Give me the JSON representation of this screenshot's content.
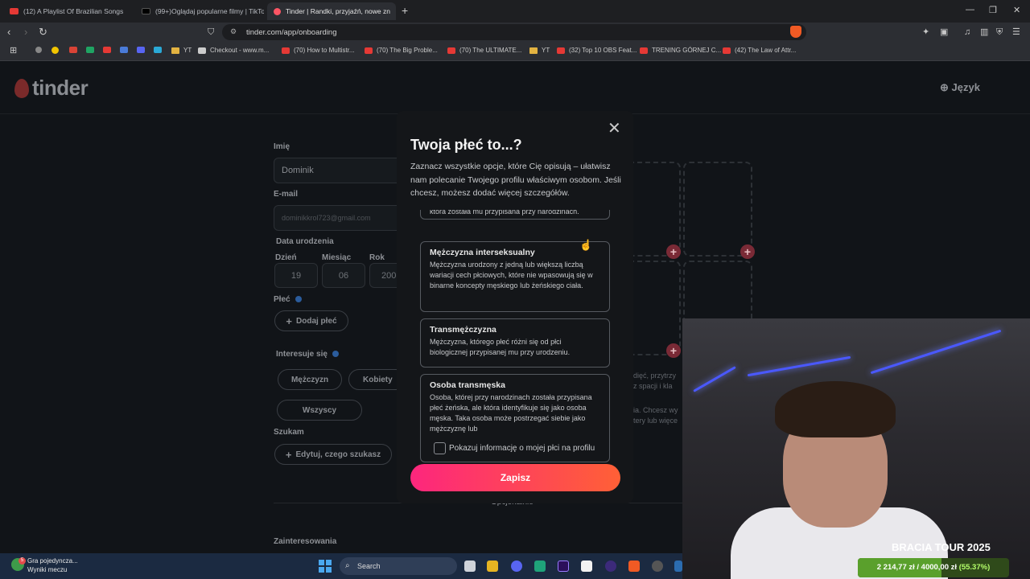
{
  "browser": {
    "tabs": [
      {
        "title": "(12) A Playlist Of Brazilian Songs",
        "color": "#e53935"
      },
      {
        "title": "(99+)Oglądaj popularne filmy | TikTok",
        "color": "#222222"
      },
      {
        "title": "Tinder | Randki, przyjaźń, nowe zn",
        "color": "#fd5564"
      }
    ],
    "url": "tinder.com/app/onboarding",
    "bookmarks": [
      {
        "label": "YT",
        "type": "folder"
      },
      {
        "label": "Checkout - www.m...",
        "type": "site"
      },
      {
        "label": "(70) How to Multistr...",
        "type": "yt"
      },
      {
        "label": "(70) The Big Proble...",
        "type": "yt"
      },
      {
        "label": "(70) The ULTIMATE...",
        "type": "yt"
      },
      {
        "label": "YT",
        "type": "folder"
      },
      {
        "label": "(32) Top 10 OBS Feat...",
        "type": "yt"
      },
      {
        "label": "TRENING GÓRNEJ C...",
        "type": "yt"
      },
      {
        "label": "(42) The Law of Attr...",
        "type": "yt"
      }
    ]
  },
  "page": {
    "logo": "tinder",
    "language": "Język",
    "form": {
      "name_label": "Imię",
      "name_value": "Dominik",
      "email_label": "E-mail",
      "email_value": "dominikkrol723@gmail.com",
      "dob_label": "Data urodzenia",
      "day_label": "Dzień",
      "day_value": "19",
      "month_label": "Miesiąc",
      "month_value": "06",
      "year_label": "Rok",
      "year_value": "200",
      "gender_label": "Płeć",
      "add_gender": "Dodaj płeć",
      "interested_label": "Interesuje się",
      "interest_options": [
        "Mężczyzn",
        "Kobiety",
        "Wszyscy"
      ],
      "looking_label": "Szukam",
      "edit_looking": "Edytuj, czego szukasz",
      "optional": "Opcjonalnie",
      "interests_label": "Zainteresowania"
    },
    "ghost_text": [
      "dięć, przytrzy",
      "z spacji i kla",
      "ia. Chcesz wy",
      "tery lub więce"
    ]
  },
  "modal": {
    "title": "Twoja płeć to...?",
    "description": "Zaznacz wszystkie opcje, które Cię opisują – ułatwisz nam polecanie Twojego profilu właściwym osobom. Jeśli chcesz, możesz dodać więcej szczegółów.",
    "partial_option_text": "która została mu przypisana przy narodzinach.",
    "options": [
      {
        "title": "Mężczyzna interseksualny",
        "desc": "Mężczyzna urodzony z jedną lub większą liczbą wariacji cech płciowych, które nie wpasowują się w binarne koncepty męskiego lub żeńskiego ciała."
      },
      {
        "title": "Transmężczyzna",
        "desc": "Mężczyzna, którego płeć różni się od płci biologicznej przypisanej mu przy urodzeniu."
      },
      {
        "title": "Osoba transmęska",
        "desc": "Osoba, której przy narodzinach została przypisana płeć żeńska, ale która identyfikuje się jako osoba męska. Taka osoba może postrzegać siebie jako mężczyznę lub"
      }
    ],
    "show_on_profile": "Pokazuj informację o mojej płci na profilu",
    "save": "Zapisz"
  },
  "stream": {
    "tour": "BRACIA TOUR 2025",
    "goal_text": "2 214,77 zł / 4000,00 zł",
    "goal_pct": "(55.37%)",
    "goal_fraction": 0.5537
  },
  "taskbar": {
    "weather_title": "Gra pojedyncza...",
    "weather_sub": "Wyniki meczu",
    "weather_badge": "5",
    "search": "Search"
  }
}
